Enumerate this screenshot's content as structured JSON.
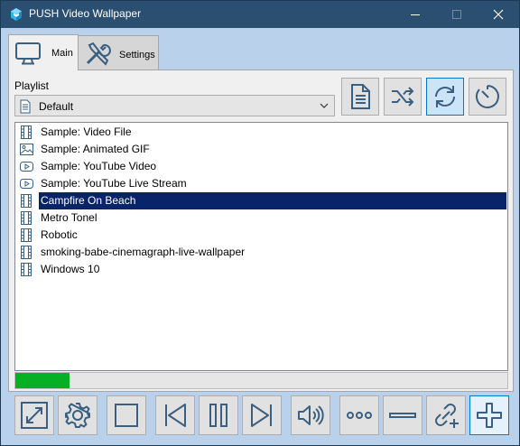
{
  "window": {
    "title": "PUSH Video Wallpaper",
    "accent": "#2b4f70"
  },
  "tabs": [
    {
      "label": "Main",
      "icon": "monitor-icon",
      "active": true
    },
    {
      "label": "Settings",
      "icon": "tools-icon",
      "active": false
    }
  ],
  "playlist": {
    "label": "Playlist",
    "selected": "Default"
  },
  "toolbar": {
    "buttons": [
      {
        "icon": "document-icon",
        "active": false
      },
      {
        "icon": "shuffle-icon",
        "active": false
      },
      {
        "icon": "repeat-icon",
        "active": true
      },
      {
        "icon": "timer-icon",
        "active": false
      }
    ]
  },
  "items": [
    {
      "label": "Sample: Video File",
      "icon": "film-icon",
      "selected": false
    },
    {
      "label": "Sample: Animated GIF",
      "icon": "image-icon",
      "selected": false
    },
    {
      "label": "Sample: YouTube Video",
      "icon": "play-icon",
      "selected": false
    },
    {
      "label": "Sample: YouTube Live Stream",
      "icon": "play-icon",
      "selected": false
    },
    {
      "label": "Campfire On Beach",
      "icon": "film-icon",
      "selected": true
    },
    {
      "label": "Metro Tonel",
      "icon": "film-icon",
      "selected": false
    },
    {
      "label": "Robotic",
      "icon": "film-icon",
      "selected": false
    },
    {
      "label": "smoking-babe-cinemagraph-live-wallpaper",
      "icon": "film-icon",
      "selected": false
    },
    {
      "label": "Windows 10",
      "icon": "film-icon",
      "selected": false
    }
  ],
  "progress": {
    "fraction": 0.11,
    "color": "#06b025"
  },
  "controls": [
    {
      "icon": "fullscreen-icon"
    },
    {
      "icon": "gear-icon"
    },
    {
      "icon": "stop-icon"
    },
    {
      "icon": "previous-icon"
    },
    {
      "icon": "pause-icon"
    },
    {
      "icon": "next-icon"
    },
    {
      "icon": "volume-icon"
    },
    {
      "icon": "more-icon"
    },
    {
      "icon": "remove-icon"
    },
    {
      "icon": "add-url-icon"
    },
    {
      "icon": "add-icon",
      "active": true
    }
  ]
}
